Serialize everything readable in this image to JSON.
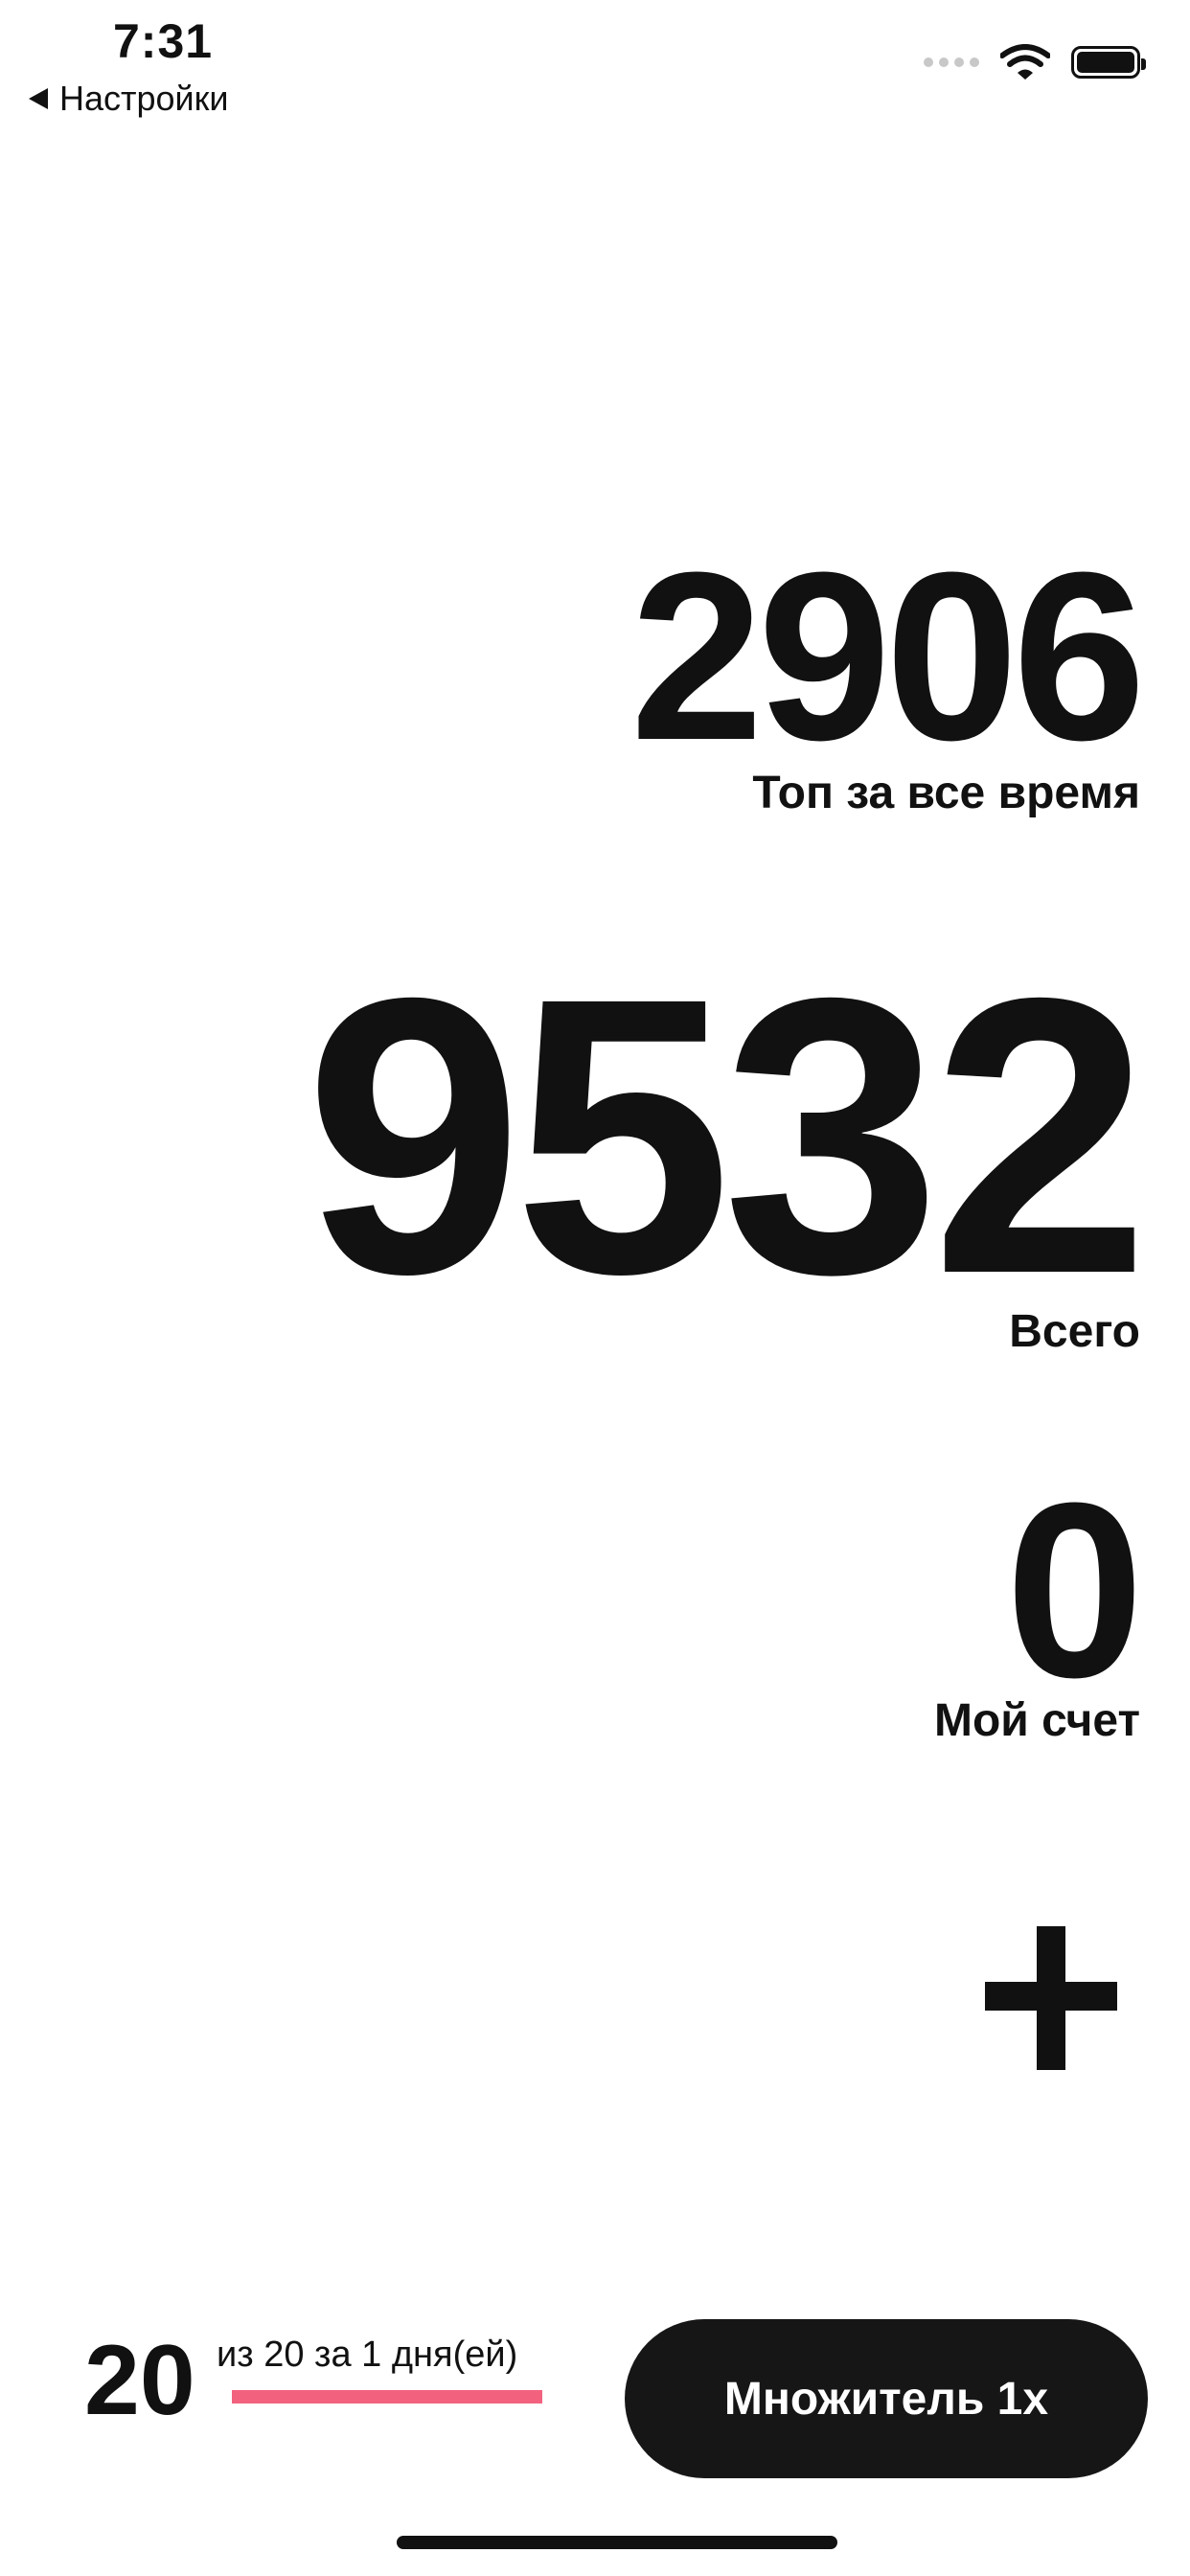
{
  "status_bar": {
    "time": "7:31",
    "back_label": "Настройки",
    "wifi_icon": "wifi-icon",
    "battery_icon": "battery-icon",
    "battery_level": 1.0
  },
  "stats": {
    "top_all_time": {
      "value": "2906",
      "label": "Топ за все время"
    },
    "total": {
      "value": "9532",
      "label": "Всего"
    },
    "my_score": {
      "value": "0",
      "label": "Мой счет"
    }
  },
  "actions": {
    "plus_icon": "plus-icon"
  },
  "daily": {
    "count": "20",
    "caption": "из 20 за 1 дня(ей)",
    "progress": 1.0,
    "progress_color": "#f2627f"
  },
  "multiplier": {
    "label": "Множитель 1x"
  },
  "colors": {
    "text": "#111111",
    "background": "#ffffff",
    "button": "#161616",
    "accent": "#f2627f"
  }
}
